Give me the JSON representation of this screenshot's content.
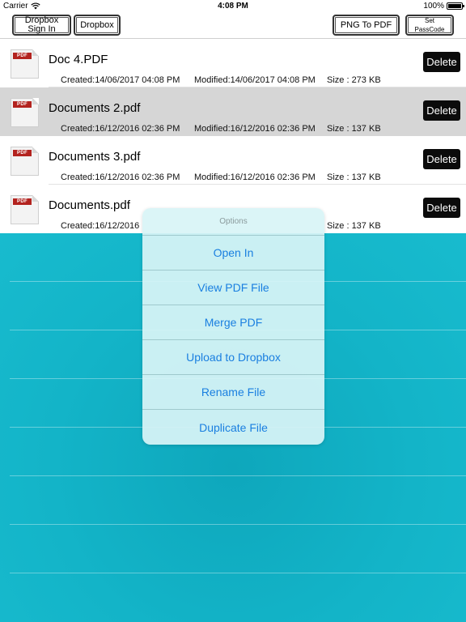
{
  "status_bar": {
    "carrier": "Carrier",
    "time": "4:08 PM",
    "battery": "100%"
  },
  "toolbar": {
    "dropbox_signin": "Dropbox Sign In",
    "dropbox": "Dropbox",
    "png_to_pdf": "PNG To PDF",
    "set_passcode": "Set PassCode"
  },
  "files": [
    {
      "name": "Doc 4.PDF",
      "created": "Created:14/06/2017 04:08 PM",
      "modified": "Modified:14/06/2017 04:08 PM",
      "size": "Size : 273 KB",
      "badge": "PDF",
      "delete_label": "Delete"
    },
    {
      "name": "Documents 2.pdf",
      "created": "Created:16/12/2016 02:36 PM",
      "modified": "Modified:16/12/2016 02:36 PM",
      "size": "Size : 137 KB",
      "badge": "PDF",
      "delete_label": "Delete"
    },
    {
      "name": "Documents 3.pdf",
      "created": "Created:16/12/2016 02:36 PM",
      "modified": "Modified:16/12/2016 02:36 PM",
      "size": "Size : 137 KB",
      "badge": "PDF",
      "delete_label": "Delete"
    },
    {
      "name": "Documents.pdf",
      "created": "Created:16/12/2016",
      "modified": "",
      "size": "Size : 137 KB",
      "badge": "PDF",
      "delete_label": "Delete"
    }
  ],
  "options_menu": {
    "title": "Options",
    "items": [
      "Open In",
      "View PDF File",
      "Merge PDF",
      "Upload to Dropbox",
      "Rename File",
      "Duplicate File"
    ]
  },
  "colors": {
    "teal_background": "#13b4c8",
    "link_blue": "#1a7fe0",
    "delete_button": "#0b0b0b",
    "selected_row": "#d6d6d6",
    "pdf_badge": "#b3231f"
  }
}
